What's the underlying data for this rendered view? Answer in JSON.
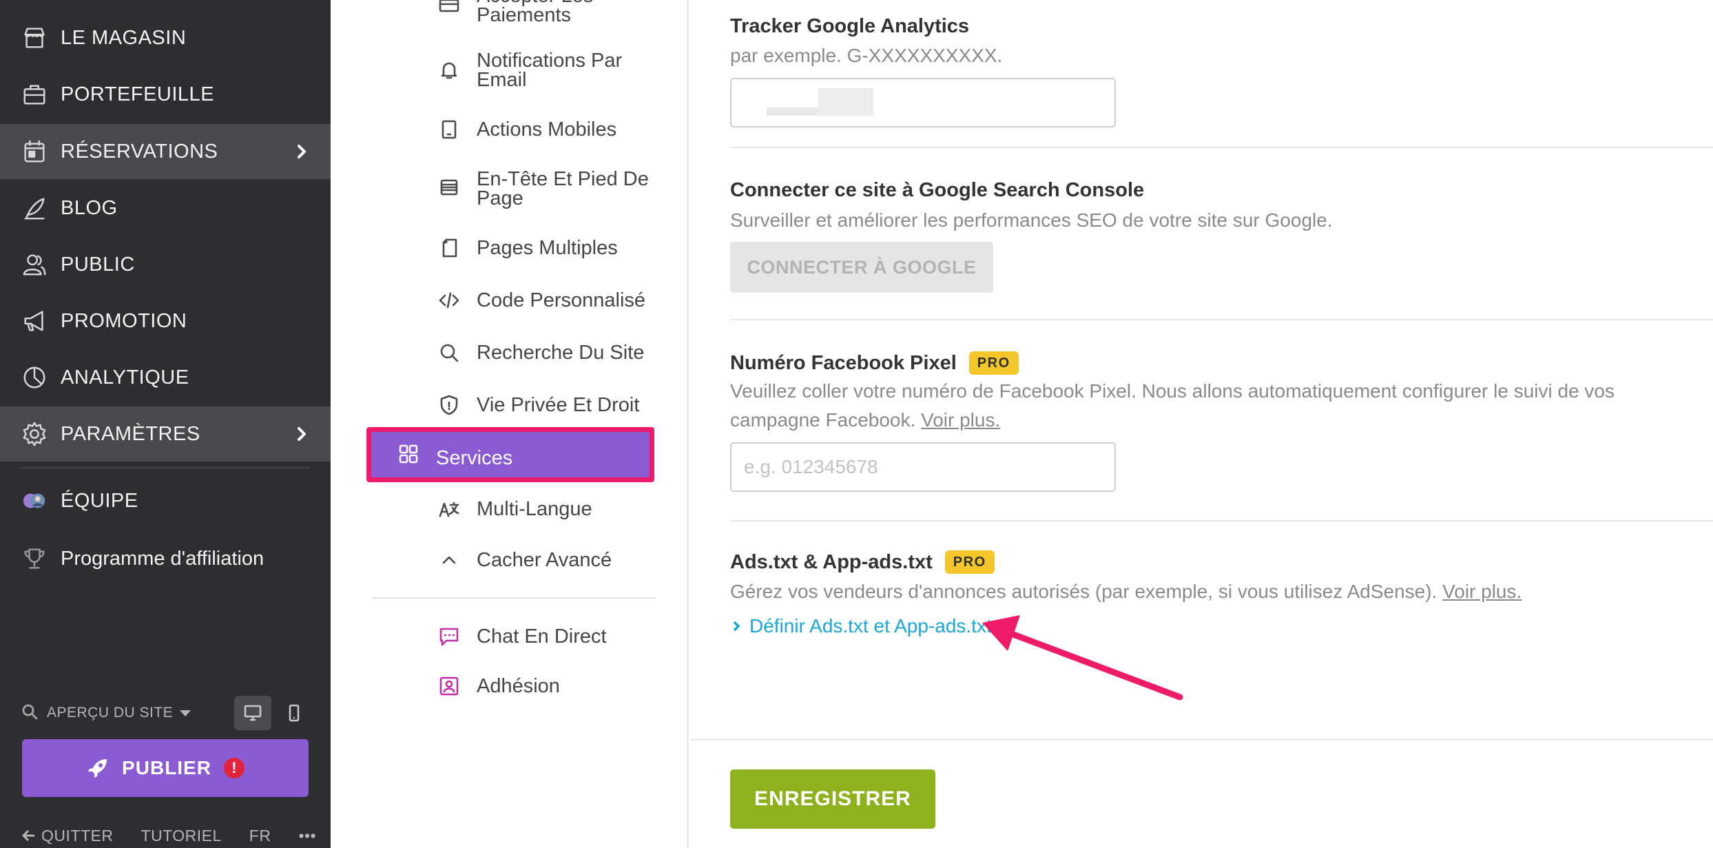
{
  "sidebar": {
    "nav": [
      {
        "label": "LE MAGASIN",
        "icon": "store-icon"
      },
      {
        "label": "PORTEFEUILLE",
        "icon": "briefcase-icon"
      },
      {
        "label": "RÉSERVATIONS",
        "icon": "calendar-icon"
      },
      {
        "label": "BLOG",
        "icon": "feather-icon"
      },
      {
        "label": "PUBLIC",
        "icon": "users-icon"
      },
      {
        "label": "PROMOTION",
        "icon": "megaphone-icon"
      },
      {
        "label": "ANALYTIQUE",
        "icon": "pie-chart-icon"
      },
      {
        "label": "PARAMÈTRES",
        "icon": "gear-icon"
      },
      {
        "label": "ÉQUIPE",
        "icon": "team-avatars-icon"
      },
      {
        "label": "Programme d'affiliation",
        "icon": "trophy-icon"
      }
    ],
    "preview_label": "APERÇU DU SITE",
    "publish_label": "PUBLIER",
    "publish_badge": "!",
    "footer": {
      "quit": "QUITTER",
      "tutorial": "TUTORIEL",
      "lang": "FR",
      "more": "•••"
    },
    "colors": {
      "background": "#2e2e30",
      "active": "#48484d",
      "publish": "#8a5bd2"
    }
  },
  "submenu": {
    "items": [
      {
        "label": "Accepter Les Paiements",
        "icon": "credit-card-icon"
      },
      {
        "label": "Notifications Par Email",
        "icon": "bell-icon"
      },
      {
        "label": "Actions Mobiles",
        "icon": "tablet-icon"
      },
      {
        "label": "En-Tête Et Pied De Page",
        "icon": "layout-icon"
      },
      {
        "label": "Pages Multiples",
        "icon": "pages-icon"
      },
      {
        "label": "Code Personnalisé",
        "icon": "code-icon"
      },
      {
        "label": "Recherche Du Site",
        "icon": "search-icon"
      },
      {
        "label": "Vie Privée Et Droit",
        "icon": "shield-icon"
      },
      {
        "label": "Services",
        "icon": "grid-icon"
      },
      {
        "label": "Multi-Langue",
        "icon": "language-icon"
      },
      {
        "label": "Cacher Avancé",
        "icon": "chevron-up-icon"
      },
      {
        "label": "Chat En Direct",
        "icon": "chat-icon"
      },
      {
        "label": "Adhésion",
        "icon": "member-icon"
      }
    ],
    "highlight_color": "#ee1b68"
  },
  "main": {
    "ga": {
      "title": "Tracker Google Analytics",
      "description": "par exemple. G-XXXXXXXXXX.",
      "value": ""
    },
    "gsc": {
      "title": "Connecter ce site à Google Search Console",
      "description": "Surveiller et améliorer les performances SEO de votre site sur Google.",
      "button": "CONNECTER À GOOGLE"
    },
    "fb": {
      "title": "Numéro Facebook Pixel",
      "badge": "PRO",
      "description": "Veuillez coller votre numéro de Facebook Pixel. Nous allons automatiquement configurer le suivi de vos",
      "description2": "campagne Facebook.",
      "link": "Voir plus.",
      "placeholder": "e.g. 012345678"
    },
    "ads": {
      "title": "Ads.txt & App-ads.txt",
      "badge": "PRO",
      "description": "Gérez vos vendeurs d'annonces autorisés (par exemple, si vous utilisez AdSense).",
      "link": "Voir plus.",
      "action": "Définir Ads.txt et App-ads.txt"
    },
    "save": "ENREGISTRER",
    "colors": {
      "link": "#1aa8d8",
      "save": "#8db21d",
      "pro": "#f3c62b",
      "arrow": "#ee1b68"
    }
  }
}
